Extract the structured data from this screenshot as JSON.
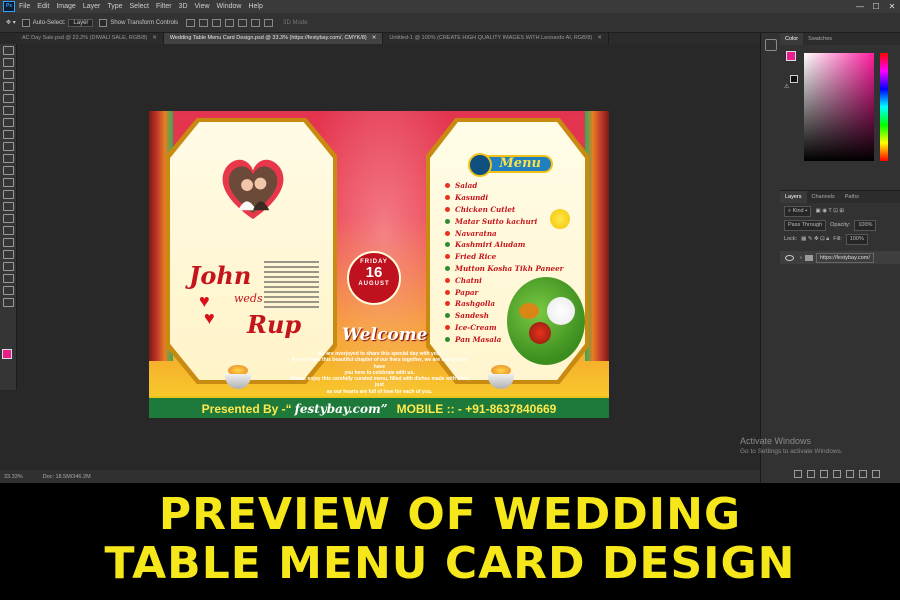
{
  "menubar": {
    "app_icon": "Ps",
    "items": [
      "File",
      "Edit",
      "Image",
      "Layer",
      "Type",
      "Select",
      "Filter",
      "3D",
      "View",
      "Window",
      "Help"
    ]
  },
  "window_controls": {
    "minimize": "—",
    "maximize": "☐",
    "close": "✕"
  },
  "options_bar": {
    "auto_select": "Auto-Select:",
    "auto_select_target": "Layer",
    "show_transform": "Show Transform Controls",
    "mode_3d": "3D Mode:"
  },
  "doc_tabs": [
    {
      "label": "AC Day Sale.psd @ 22.2% (DIWALI SALE, RGB/8)",
      "active": false
    },
    {
      "label": "Wedding Table Menu Card Design.psd @ 33.3% (https://festybay.com/, CMYK/8)",
      "active": true
    },
    {
      "label": "Untitled-1 @ 100% (CREATE HIGH QUALITY IMAGES WITH Leonardo AI, RGB/8)",
      "active": false
    }
  ],
  "status_bar": {
    "zoom": "33.33%",
    "doc_size": "Doc: 18.5M/346.2M"
  },
  "panels": {
    "color_tabs": [
      "Color",
      "Swatches"
    ],
    "foreground_color": "#e91e8c",
    "layers_tabs": [
      "Layers",
      "Channels",
      "Paths"
    ],
    "kind_filter": "Kind",
    "blend_mode": "Pass Through",
    "opacity_label": "Opacity:",
    "opacity_value": "100%",
    "lock_label": "Lock:",
    "fill_label": "Fill:",
    "fill_value": "100%",
    "layer_name": "https://festybay.com/"
  },
  "watermark": {
    "title": "Activate Windows",
    "subtitle": "Go to Settings to activate Windows."
  },
  "card": {
    "groom": "John",
    "weds": "weds",
    "bride": "Rup",
    "date_day": "FRIDAY",
    "date_num": "16",
    "date_month": "AUGUST",
    "welcome": "Welcome",
    "invitation": [
      "We are overjoyed to share this special day with you!",
      "As we begin this beautiful chapter of our lives together, we are honored to have",
      "you here to celebrate with us.",
      "Please enjoy this carefully curated menu, filled with dishes made with love, just",
      "as our hearts are full of love for each of you."
    ],
    "menu_title": "Menu",
    "menu_items": [
      {
        "name": "Salad",
        "color": "#e8331c"
      },
      {
        "name": "Kasundi",
        "color": "#e8331c"
      },
      {
        "name": "Chicken Cutlet",
        "color": "#e8331c"
      },
      {
        "name": "Matar Sutto kachuri",
        "color": "#2e8b2e"
      },
      {
        "name": "Navaratna",
        "color": "#e8331c"
      },
      {
        "name": "Kashmiri Aludam",
        "color": "#2e8b2e"
      },
      {
        "name": "Fried Rice",
        "color": "#e8331c"
      },
      {
        "name": "Mutton Kosha   Tikh   Paneer",
        "color": "#2e8b2e"
      },
      {
        "name": "Chatni",
        "color": "#e8331c"
      },
      {
        "name": "Papar",
        "color": "#e8331c"
      },
      {
        "name": "Rashgolla",
        "color": "#e8331c"
      },
      {
        "name": "Sandesh",
        "color": "#2e8b2e"
      },
      {
        "name": "Ice-Cream",
        "color": "#e8331c"
      },
      {
        "name": "Pan Masala",
        "color": "#2e8b2e"
      }
    ],
    "footer_presented": "Presented By -“",
    "footer_brand": "festybay.com”",
    "footer_mobile": "MOBILE :: - +91-8637840669"
  },
  "caption": {
    "line1": "PREVIEW OF WEDDING",
    "line2": "TABLE MENU CARD DESIGN"
  }
}
